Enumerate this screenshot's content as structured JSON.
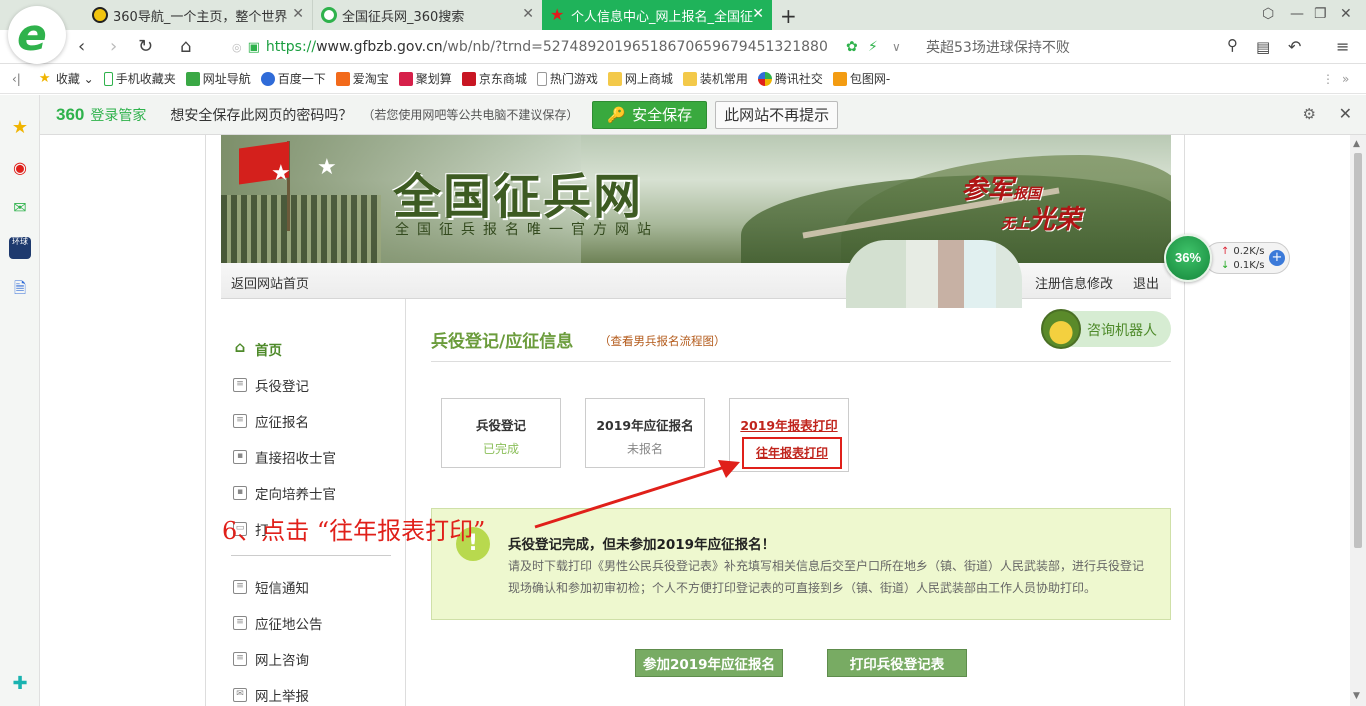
{
  "browser": {
    "tabs": [
      {
        "title": "360导航_一个主页，整个世界",
        "active": false
      },
      {
        "title": "全国征兵网_360搜索",
        "active": false
      },
      {
        "title": "个人信息中心_网上报名_全国征",
        "active": true
      }
    ],
    "url": {
      "scheme": "https://",
      "host": "www.gfbzb.gov.cn",
      "path": "/wb/nb/?trnd=52748920196518670659679451321880"
    },
    "search_text": "英超53场进球保持不败",
    "bookmarks": [
      "收藏",
      "手机收藏夹",
      "网址导航",
      "百度一下",
      "爱淘宝",
      "聚划算",
      "京东商城",
      "热门游戏",
      "网上商城",
      "装机常用",
      "腾讯社交",
      "包图网-"
    ]
  },
  "password_bar": {
    "brand": "360",
    "brand_sub": "登录管家",
    "question": "想安全保存此网页的密码吗？",
    "hint": "（若您使用网吧等公共电脑不建议保存）",
    "save_label": "安全保存",
    "never_label": "此网站不再提示"
  },
  "site": {
    "banner_title": "全国征兵网",
    "banner_subtitle": "全国征兵报名唯一官方网站",
    "slogan_a": "参军",
    "slogan_b": "报国",
    "slogan_c": "无上",
    "slogan_d": "光荣",
    "nav_home": "返回网站首页",
    "nav_edit": "注册信息修改",
    "nav_logout": "退出",
    "menu": [
      {
        "label": "首页",
        "icon": "home-icon",
        "active": true
      },
      {
        "label": "兵役登记",
        "icon": "clipboard-icon",
        "active": false
      },
      {
        "label": "应征报名",
        "icon": "form-icon",
        "active": false
      },
      {
        "label": "直接招收士官",
        "icon": "id-card-icon",
        "active": false
      },
      {
        "label": "定向培养士官",
        "icon": "id-card-icon",
        "active": false
      },
      {
        "label": "打",
        "icon": "print-icon",
        "active": false
      },
      {
        "label": "短信通知",
        "icon": "message-icon",
        "active": false
      },
      {
        "label": "应征地公告",
        "icon": "message-icon",
        "active": false
      },
      {
        "label": "网上咨询",
        "icon": "message-icon",
        "active": false
      },
      {
        "label": "网上举报",
        "icon": "mail-icon",
        "active": false
      }
    ],
    "section_title": "兵役登记/应征信息",
    "section_link": "（查看男兵报名流程图）",
    "robot_label": "咨询机器人",
    "cards": [
      {
        "title": "兵役登记",
        "status": "已完成",
        "status_color": "#8bbf5a"
      },
      {
        "title": "2019年应征报名",
        "status": "未报名",
        "status_color": "#888888"
      },
      {
        "title": "2019年报表打印",
        "status": "",
        "status_color": "#c0241c"
      }
    ],
    "highlight_link": "往年报表打印",
    "notice": {
      "heading": "兵役登记完成，但未参加2019年应征报名！",
      "body1": "请及时下载打印《男性公民兵役登记表》补充填写相关信息后交至户口所在地乡（镇、街道）人民武装部，进行兵役登记",
      "body2": "现场确认和参加初审初检；个人不方便打印登记表的可直接到乡（镇、街道）人民武装部由工作人员协助打印。"
    },
    "buttons": [
      "参加2019年应征报名",
      "打印兵役登记表"
    ]
  },
  "annotation": "6、点击 “往年报表打印”",
  "net_widget": {
    "percent": "36%",
    "up": "0.2K/s",
    "down": "0.1K/s"
  },
  "colors": {
    "accent_green": "#1fb35a",
    "site_green": "#6b9c3c",
    "alert_red": "#e0201a"
  }
}
